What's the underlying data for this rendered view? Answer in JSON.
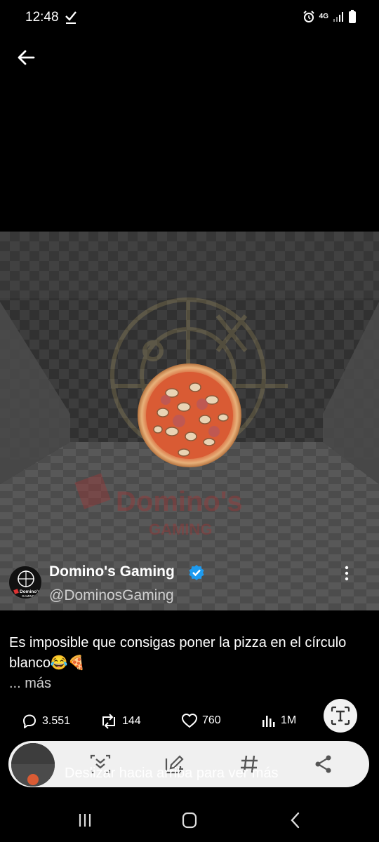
{
  "status_bar": {
    "time": "12:48",
    "network": "4G"
  },
  "post": {
    "author_name": "Domino's Gaming",
    "author_handle": "@DominosGaming",
    "avatar_text": "Domino's",
    "avatar_subtext": "GAMING",
    "text": "Es imposible que consigas poner la pizza en el círculo blanco😂🍕",
    "more_label": "... más",
    "video_watermark": "Domino's",
    "video_watermark_sub": "GAMING"
  },
  "actions": {
    "replies": "3.551",
    "reposts": "144",
    "likes": "760",
    "views": "1M"
  },
  "overlay": {
    "hint": "Deslizar hacia arriba para ver más"
  },
  "colors": {
    "verified": "#1d9bf0",
    "background": "#000000"
  }
}
